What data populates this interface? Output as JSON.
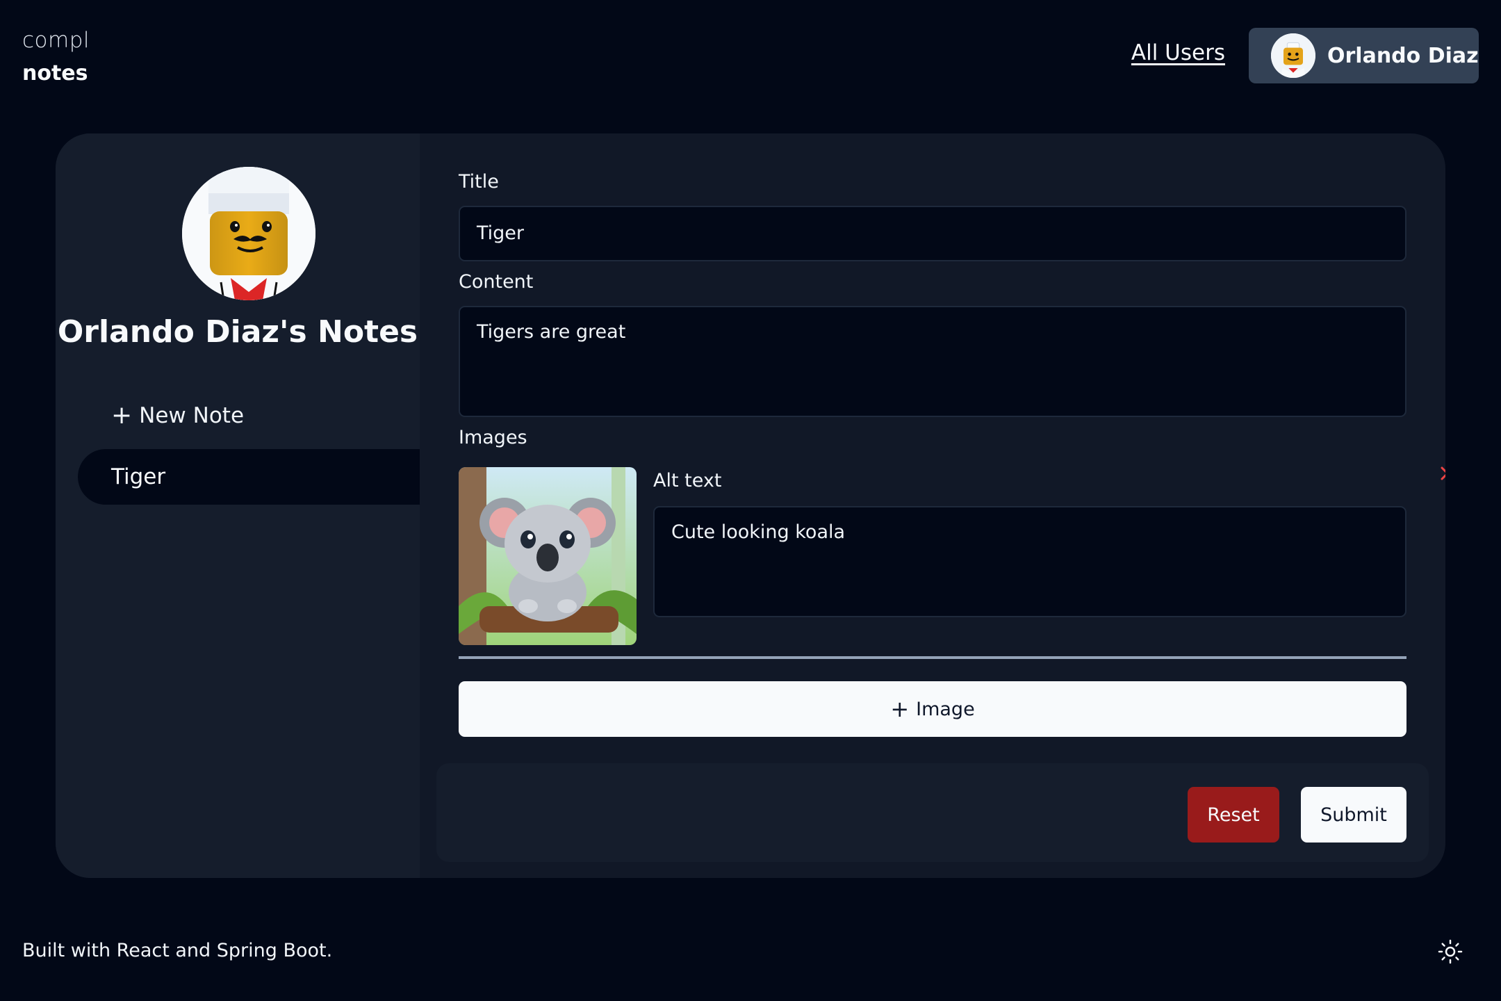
{
  "header": {
    "logo_top": "compl",
    "logo_bottom": "notes",
    "all_users_link": "All Users",
    "user_name": "Orlando Diaz"
  },
  "sidebar": {
    "notes_title": "Orlando Diaz's Notes",
    "new_note_label": "New Note",
    "notes": [
      {
        "title": "Tiger",
        "active": true
      }
    ]
  },
  "form": {
    "title_label": "Title",
    "title_value": "Tiger",
    "content_label": "Content",
    "content_value": "Tigers are great",
    "images_label": "Images",
    "alt_text_label": "Alt text",
    "alt_text_value": "Cute looking koala",
    "add_image_label": "Image",
    "reset_label": "Reset",
    "submit_label": "Submit"
  },
  "footer": {
    "text": "Built with React and Spring Boot."
  },
  "colors": {
    "background": "#020817",
    "card": "#111827",
    "sidebar": "#151d2c",
    "reset": "#991b1b",
    "close_icon": "#ef4444"
  }
}
